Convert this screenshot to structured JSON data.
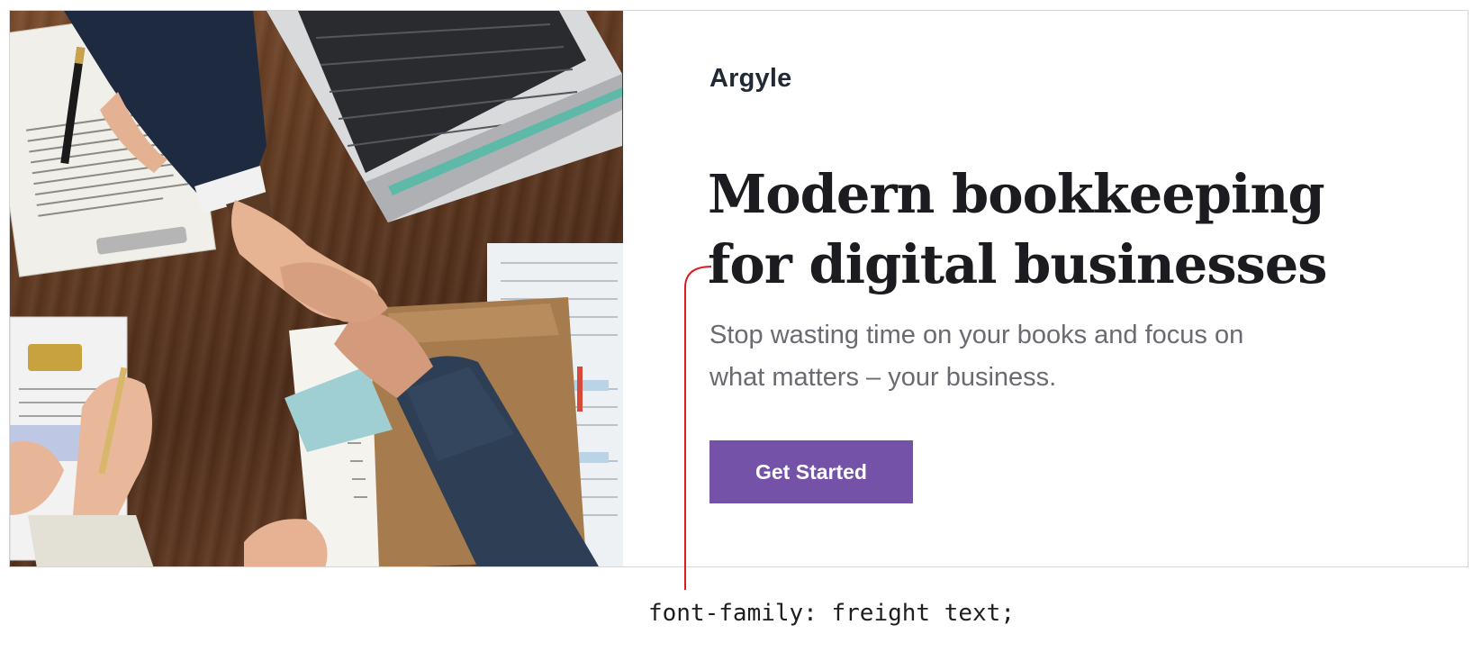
{
  "hero": {
    "brand": "Argyle",
    "headline_line1": "Modern bookkeeping",
    "headline_line2": "for digital businesses",
    "subtext_line1": "Stop wasting time on your books and focus on",
    "subtext_line2": "what matters – your business.",
    "cta_label": "Get Started",
    "photo_alt": "Business handshake over a desk with laptop and contracts"
  },
  "annotation": {
    "label": "font-family: freight text;"
  },
  "colors": {
    "accent": "#7352a8",
    "annotation_line": "#e0191c",
    "headline": "#1b1b20",
    "subtext": "#6a6a72"
  }
}
